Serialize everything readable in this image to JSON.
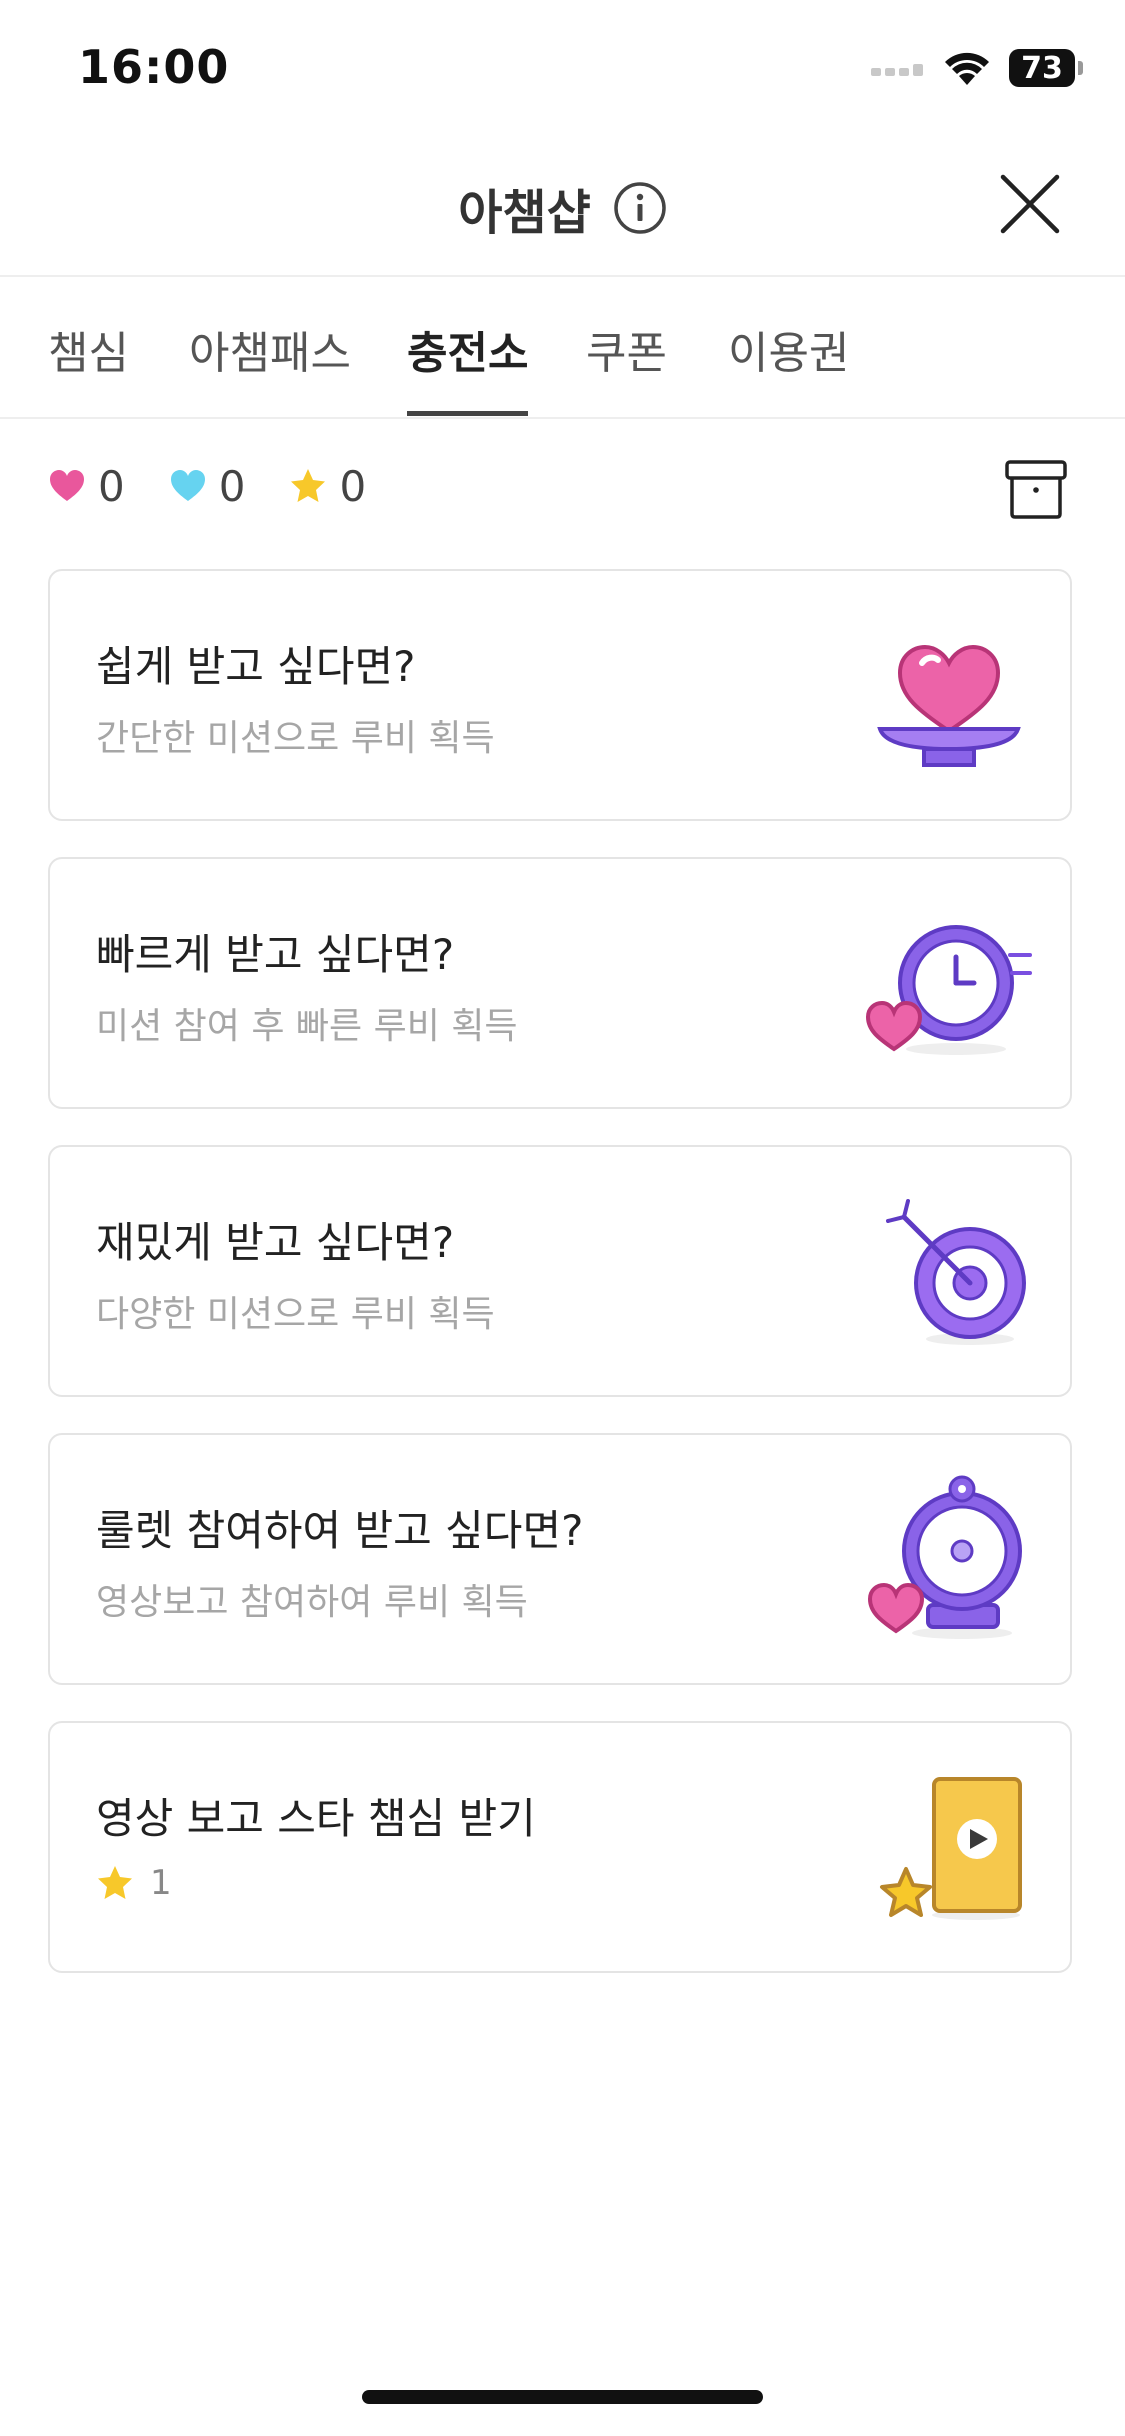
{
  "status_bar": {
    "time": "16:00",
    "battery": "73"
  },
  "header": {
    "title": "아챔샵"
  },
  "tabs": [
    {
      "label": "챔심",
      "active": false
    },
    {
      "label": "아챔패스",
      "active": false
    },
    {
      "label": "충전소",
      "active": true
    },
    {
      "label": "쿠폰",
      "active": false
    },
    {
      "label": "이용권",
      "active": false
    }
  ],
  "currencies": {
    "pink_heart": "0",
    "blue_heart": "0",
    "star": "0"
  },
  "cards": [
    {
      "title": "쉽게 받고 싶다면?",
      "subtitle": "간단한 미션으로 루비 획득",
      "icon": "heart-plate-icon"
    },
    {
      "title": "빠르게 받고 싶다면?",
      "subtitle": "미션 참여 후 빠른 루비 획득",
      "icon": "clock-heart-icon"
    },
    {
      "title": "재밌게 받고 싶다면?",
      "subtitle": "다양한 미션으로 루비 획득",
      "icon": "target-icon"
    },
    {
      "title": "룰렛 참여하여 받고 싶다면?",
      "subtitle": "영상보고 참여하여 루비 획득",
      "icon": "roulette-heart-icon"
    },
    {
      "title": "영상 보고 스타 챔심 받기",
      "reward": "1",
      "icon": "phone-video-star-icon"
    }
  ],
  "colors": {
    "pink": "#e9579c",
    "blue": "#66d3f0",
    "star": "#f7c82a",
    "purple": "#7a4fe0"
  }
}
